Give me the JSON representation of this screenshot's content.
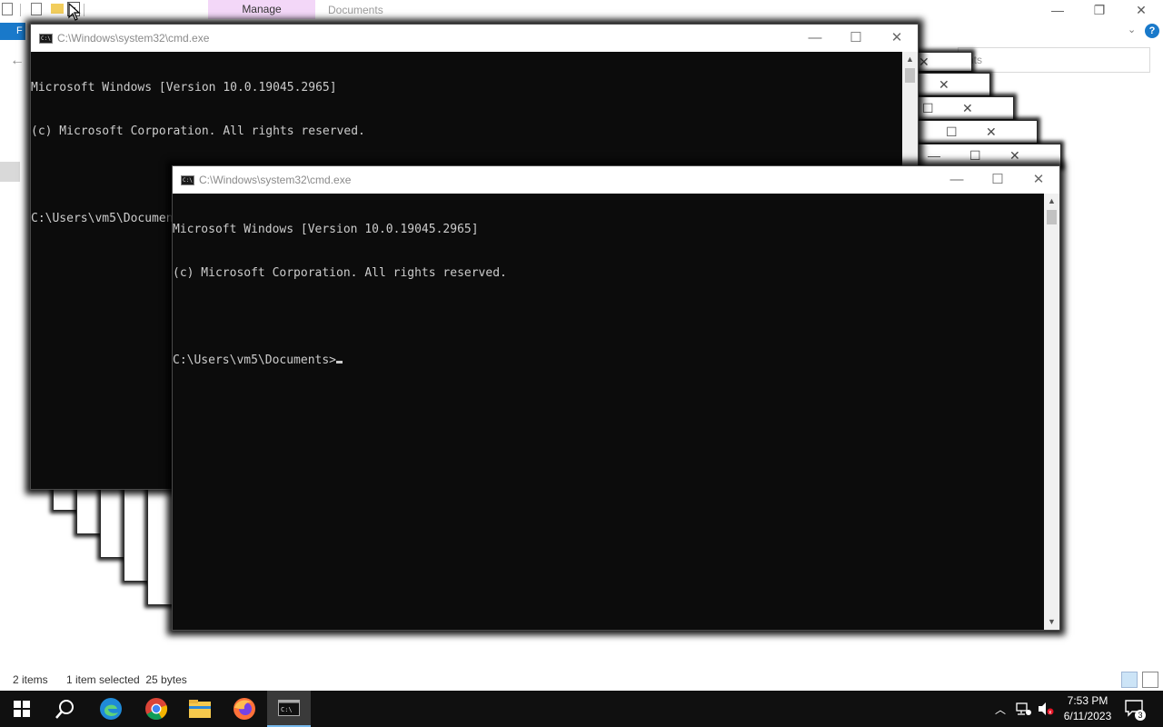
{
  "explorer": {
    "ribbon_manage_label": "Manage",
    "ribbon_title": "Documents",
    "file_tab_label": "F",
    "help_glyph": "?",
    "search_placeholder_fragment": "nts",
    "status": {
      "item_count": "2 items",
      "selection": "1 item selected  25 bytes"
    }
  },
  "cmd_back": {
    "title": "C:\\Windows\\system32\\cmd.exe",
    "lines": [
      "Microsoft Windows [Version 10.0.19045.2965]",
      "(c) Microsoft Corporation. All rights reserved.",
      "",
      "C:\\Users\\vm5\\Documents>"
    ]
  },
  "cmd_front": {
    "title": "C:\\Windows\\system32\\cmd.exe",
    "lines": [
      "Microsoft Windows [Version 10.0.19045.2965]",
      "(c) Microsoft Corporation. All rights reserved.",
      "",
      "C:\\Users\\vm5\\Documents>"
    ]
  },
  "window_controls": {
    "minimize": "—",
    "maximize": "☐",
    "close": "✕"
  },
  "taskbar": {
    "items": [
      "start-icon",
      "search-icon",
      "edge-icon",
      "chrome-icon",
      "file-explorer-icon",
      "firefox-icon",
      "cmd-icon"
    ],
    "clock_time": "7:53 PM",
    "clock_date": "6/11/2023",
    "notification_count": "3"
  },
  "colors": {
    "console_bg": "#0c0c0c",
    "console_fg": "#cccccc",
    "taskbar_bg": "#101010",
    "accent": "#1979ca"
  }
}
